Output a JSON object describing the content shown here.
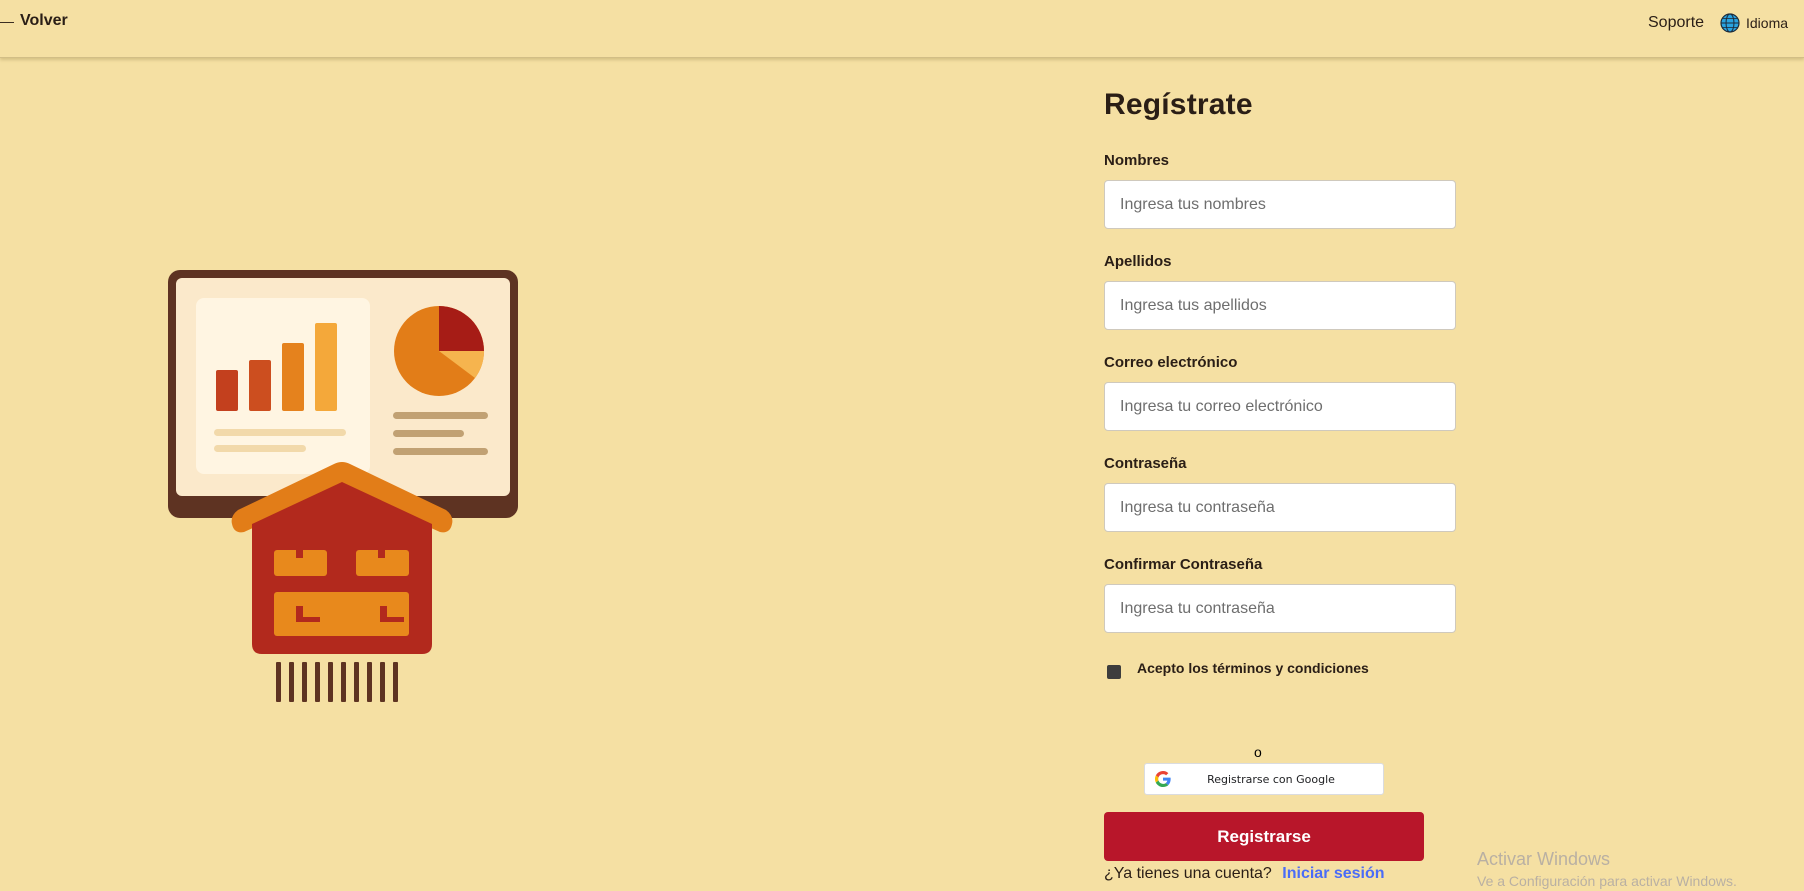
{
  "header": {
    "back_label": "Volver",
    "support_label": "Soporte",
    "language_label": "Idioma"
  },
  "form": {
    "title": "Regístrate",
    "fields": [
      {
        "label": "Nombres",
        "placeholder": "Ingresa tus nombres",
        "value": ""
      },
      {
        "label": "Apellidos",
        "placeholder": "Ingresa tus apellidos",
        "value": ""
      },
      {
        "label": "Correo electrónico",
        "placeholder": "Ingresa tu correo electrónico",
        "value": ""
      },
      {
        "label": "Contraseña",
        "placeholder": "Ingresa tu contraseña",
        "value": ""
      },
      {
        "label": "Confirmar Contraseña",
        "placeholder": "Ingresa tu contraseña",
        "value": ""
      }
    ],
    "terms_label": "Acepto los términos y condiciones",
    "or_label": "o",
    "google_label": "Registrarse con Google",
    "submit_label": "Registrarse",
    "login_prompt": "¿Ya tienes una cuenta?",
    "login_link": "Iniciar sesión"
  },
  "watermark": {
    "title": "Activar Windows",
    "subtitle": "Ve a Configuración para activar Windows."
  },
  "colors": {
    "background": "#f5e0a3",
    "primary": "#b8162a",
    "link": "#4a6cf7"
  },
  "illustration": {
    "icon_name": "warehouse-dashboard-illustration"
  }
}
